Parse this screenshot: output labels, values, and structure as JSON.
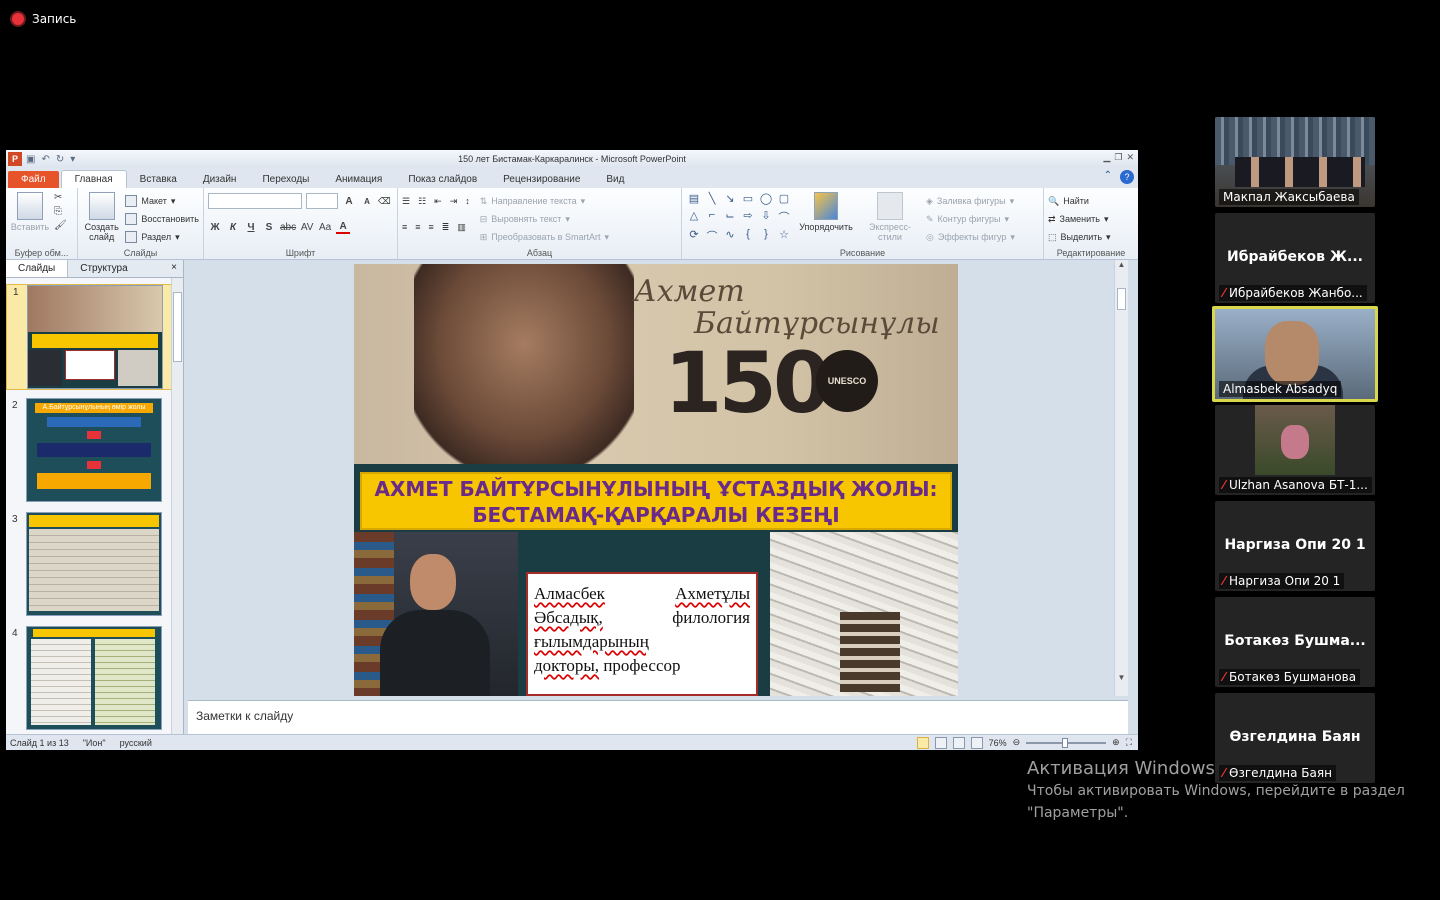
{
  "recording": {
    "label": "Запись"
  },
  "window": {
    "title": "150 лет Бистамак-Каркаралинск  -  Microsoft PowerPoint",
    "app_letter": "P"
  },
  "tabs": [
    "Файл",
    "Главная",
    "Вставка",
    "Дизайн",
    "Переходы",
    "Анимация",
    "Показ слайдов",
    "Рецензирование",
    "Вид"
  ],
  "ribbon": {
    "clipboard": {
      "paste": "Вставить",
      "label": "Буфер обм..."
    },
    "slides": {
      "new_slide": "Создать слайд",
      "layout": "Макет",
      "reset": "Восстановить",
      "section": "Раздел",
      "label": "Слайды"
    },
    "font": {
      "label": "Шрифт",
      "size_up": "A",
      "size_down": "A",
      "bold": "Ж",
      "italic": "К",
      "underline": "Ч",
      "shadow": "S",
      "strike": "abc",
      "spacing": "AV",
      "case": "Aa",
      "color": "A"
    },
    "paragraph": {
      "text_direction": "Направление текста",
      "align_text": "Выровнять текст",
      "smartart": "Преобразовать в SmartArt",
      "label": "Абзац"
    },
    "drawing": {
      "arrange": "Упорядочить",
      "quick_styles": "Экспресс-стили",
      "fill": "Заливка фигуры",
      "outline": "Контур фигуры",
      "effects": "Эффекты фигур",
      "label": "Рисование"
    },
    "editing": {
      "find": "Найти",
      "replace": "Заменить",
      "select": "Выделить",
      "label": "Редактирование"
    }
  },
  "panel": {
    "tab_slides": "Слайды",
    "tab_outline": "Структура",
    "close": "×",
    "thumbs": [
      {
        "num": "1"
      },
      {
        "num": "2",
        "title": "А.Байтұрсынұлының өмір жолы"
      },
      {
        "num": "3"
      },
      {
        "num": "4"
      }
    ]
  },
  "slide": {
    "signature_line1": "Ахмет",
    "signature_line2": "Байтұрсынұлы",
    "number": "150",
    "badge": "UNESCO",
    "banner_line1": "АХМЕТ БАЙТҰРСЫНҰЛЫНЫҢ ҰСТАЗДЫҚ ЖОЛЫ:",
    "banner_line2": "БЕСТАМАҚ-ҚАРҚАРАЛЫ КЕЗЕҢІ",
    "bio_w1": "Алмасбек",
    "bio_w2": "Ахметұлы",
    "bio_w3": "Әбсадық,",
    "bio_w4": "филология",
    "bio_w5": "ғылымдарының",
    "bio_w6": "докторы,",
    "bio_w7": "профессор"
  },
  "notes": {
    "placeholder": "Заметки к слайду"
  },
  "status": {
    "slide_of": "Слайд 1 из 13",
    "theme": "\"Ион\"",
    "lang": "русский",
    "zoom": "76%"
  },
  "participants": [
    {
      "name": "Макпал Жаксыбаева",
      "type": "video"
    },
    {
      "big": "Ибрайбеков  Ж...",
      "name": "Ибрайбеков Жанбо...",
      "muted": true
    },
    {
      "name": "Almasbek Absadyq",
      "type": "speaker"
    },
    {
      "name": "Ulzhan Asanova БТ-1...",
      "type": "photo",
      "muted": true
    },
    {
      "big": "Наргиза Опи 20 1",
      "name": "Наргиза Опи 20 1",
      "muted": true
    },
    {
      "big": "Ботакөз  Бушма...",
      "name": "Ботакөз Бушманова",
      "muted": true
    },
    {
      "big": "Өзгелдина Баян",
      "name": "Өзгелдина Баян",
      "muted": true
    }
  ],
  "activation": {
    "title": "Активация Windows",
    "line1": "Чтобы активировать Windows, перейдите в раздел",
    "line2": "\"Параметры\"."
  }
}
